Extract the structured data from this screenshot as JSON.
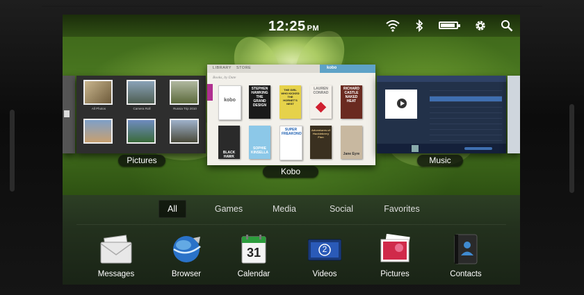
{
  "status_bar": {
    "time": "12:25",
    "ampm": "PM",
    "icons": [
      "wifi-icon",
      "bluetooth-icon",
      "battery-icon",
      "gear-icon",
      "search-icon"
    ]
  },
  "cards": {
    "pictures": {
      "label": "Pictures",
      "captions": [
        "All Photos",
        "Camera Roll",
        "Russia Trip 2010"
      ]
    },
    "kobo": {
      "label": "Kobo",
      "tab_library": "LIBRARY",
      "tab_store": "STORE",
      "logo": "kobo",
      "subhead": "Books, by Date",
      "books": [
        {
          "title": "kobo"
        },
        {
          "title": "STEPHEN HAWKING THE GRAND DESIGN"
        },
        {
          "title": "THE GIRL WHO KICKED THE HORNET'S NEST"
        },
        {
          "title": "LAUREN CONRAD"
        },
        {
          "title": "RICHARD CASTLE NAKED HEAT"
        },
        {
          "title": "BLACK HAWK DOWN"
        },
        {
          "title": "SOPHIE KINSELLA"
        },
        {
          "title": "SUPER FREAKONOMICS"
        },
        {
          "title": "Adventures of Huckleberry Finn"
        },
        {
          "title": "Jane Eyre"
        }
      ]
    },
    "music": {
      "label": "Music"
    }
  },
  "tabs": [
    {
      "label": "All",
      "active": true
    },
    {
      "label": "Games",
      "active": false
    },
    {
      "label": "Media",
      "active": false
    },
    {
      "label": "Social",
      "active": false
    },
    {
      "label": "Favorites",
      "active": false
    }
  ],
  "dock_apps": [
    {
      "label": "Messages",
      "icon": "envelope-icon"
    },
    {
      "label": "Browser",
      "icon": "globe-icon"
    },
    {
      "label": "Calendar",
      "icon": "calendar-icon",
      "day": "31"
    },
    {
      "label": "Videos",
      "icon": "film-icon",
      "badge": "2"
    },
    {
      "label": "Pictures",
      "icon": "photos-icon"
    },
    {
      "label": "Contacts",
      "icon": "contacts-icon"
    }
  ],
  "colors": {
    "wallpaper_green": "#4f7f24",
    "music_blue": "#223149",
    "kobo_accent": "#b03090"
  }
}
